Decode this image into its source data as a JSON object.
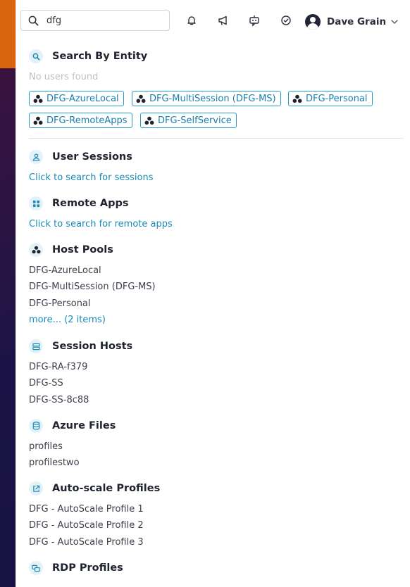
{
  "search": {
    "value": "dfg"
  },
  "user": {
    "name": "Dave Grain"
  },
  "sections": {
    "entity": {
      "title": "Search By Entity",
      "empty": "No users found",
      "chips": [
        "DFG-AzureLocal",
        "DFG-MultiSession (DFG-MS)",
        "DFG-Personal",
        "DFG-RemoteApps",
        "DFG-SelfService"
      ]
    },
    "sessions": {
      "title": "User Sessions",
      "link": "Click to search for sessions"
    },
    "remote_apps": {
      "title": "Remote Apps",
      "link": "Click to search for remote apps"
    },
    "host_pools": {
      "title": "Host Pools",
      "items": [
        "DFG-AzureLocal",
        "DFG-MultiSession (DFG-MS)",
        "DFG-Personal"
      ],
      "more": "more... (2 items)"
    },
    "session_hosts": {
      "title": "Session Hosts",
      "items": [
        "DFG-RA-f379",
        "DFG-SS",
        "DFG-SS-8c88"
      ]
    },
    "azure_files": {
      "title": "Azure Files",
      "items": [
        "profiles",
        "profilestwo"
      ]
    },
    "autoscale": {
      "title": "Auto-scale Profiles",
      "items": [
        "DFG - AutoScale Profile 1",
        "DFG - AutoScale Profile 2",
        "DFG - AutoScale Profile 3"
      ]
    },
    "rdp": {
      "title": "RDP Profiles"
    }
  },
  "colors": {
    "accent": "#1a8ab5",
    "orange": "#d9650f",
    "dark": "#1c1446"
  }
}
